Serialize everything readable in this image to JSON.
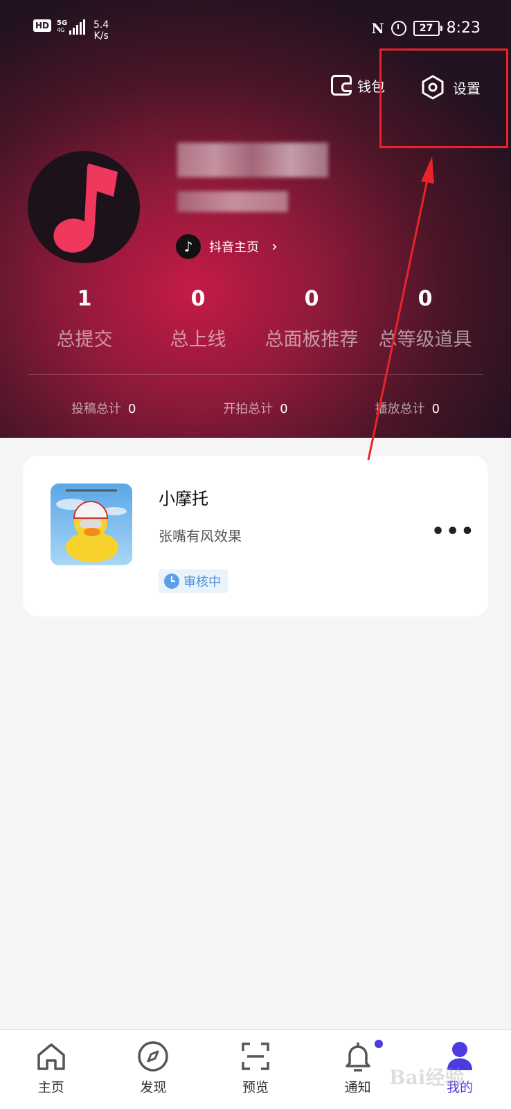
{
  "status_bar": {
    "hd": "HD",
    "network": "5G",
    "net_small": "4G",
    "speed_value": "5.4",
    "speed_unit": "K/s",
    "nfc": "N",
    "battery": "27",
    "time": "8:23"
  },
  "header": {
    "wallet_label": "钱包",
    "settings_label": "设置"
  },
  "profile": {
    "douyin_link": "抖音主页",
    "douyin_arrow": "›"
  },
  "stats": [
    {
      "value": "1",
      "label": "总提交"
    },
    {
      "value": "0",
      "label": "总上线"
    },
    {
      "value": "0",
      "label": "总面板推荐"
    },
    {
      "value": "0",
      "label": "总等级道具"
    }
  ],
  "substats": [
    {
      "label": "投稿总计",
      "value": "0"
    },
    {
      "label": "开拍总计",
      "value": "0"
    },
    {
      "label": "播放总计",
      "value": "0"
    }
  ],
  "card": {
    "title": "小摩托",
    "description": "张嘴有风效果",
    "status": "审核中",
    "more": "•••"
  },
  "tabs": [
    {
      "label": "主页",
      "icon": "home-icon"
    },
    {
      "label": "发现",
      "icon": "compass-icon"
    },
    {
      "label": "预览",
      "icon": "scan-icon"
    },
    {
      "label": "通知",
      "icon": "bell-icon"
    },
    {
      "label": "我的",
      "icon": "user-icon"
    }
  ],
  "watermark": "Bai经验",
  "colors": {
    "accent": "#4b3be0",
    "highlight": "#e8242a",
    "hero": "#c51b46"
  }
}
